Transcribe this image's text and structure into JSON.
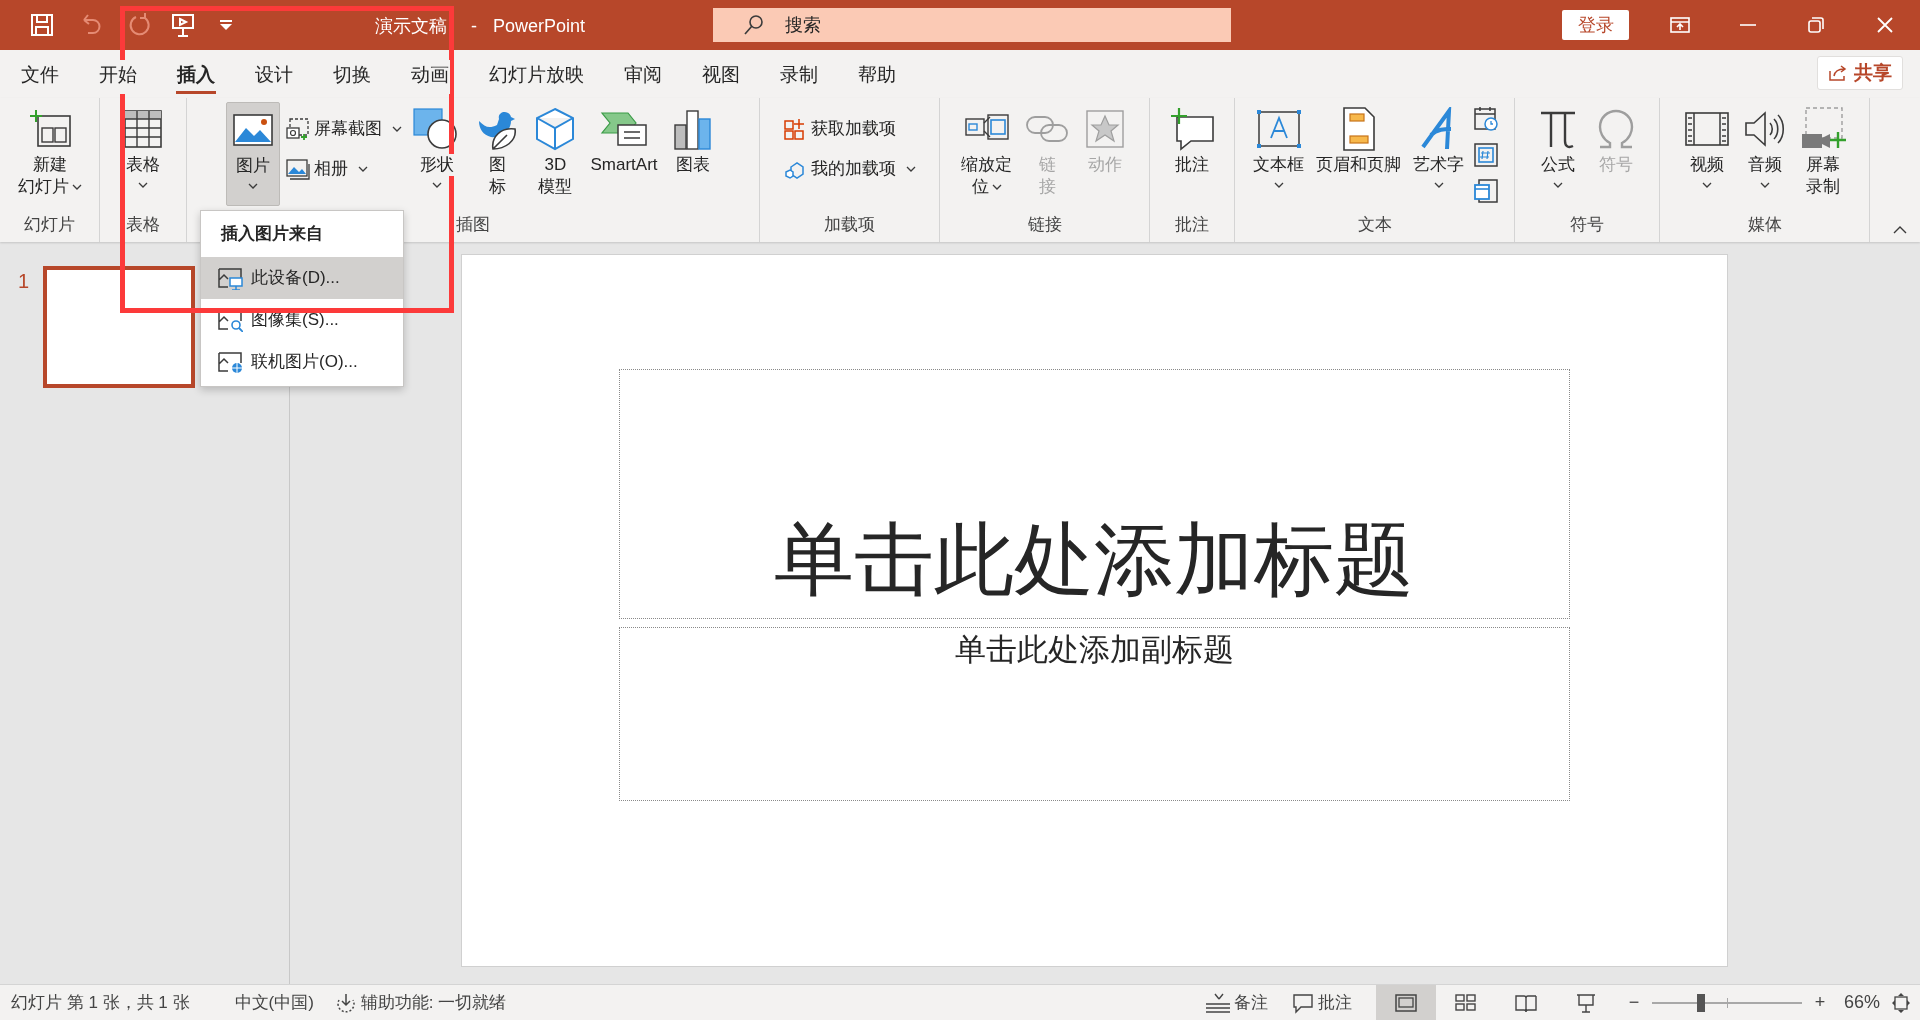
{
  "title_bar": {
    "quick_access": [
      {
        "disabled": false
      },
      {
        "disabled": true
      },
      {
        "disabled": true
      },
      {
        "disabled": false
      },
      {
        "disabled": false
      }
    ],
    "document_title": "演示文稿",
    "separator": "-",
    "app_name": "PowerPoint",
    "search": {
      "placeholder": "搜索"
    },
    "sign_in": "登录"
  },
  "tabs": [
    {
      "label": "文件",
      "selected": false
    },
    {
      "label": "开始",
      "selected": false
    },
    {
      "label": "插入",
      "selected": true
    },
    {
      "label": "设计",
      "selected": false
    },
    {
      "label": "切换",
      "selected": false
    },
    {
      "label": "动画",
      "selected": false
    },
    {
      "label": "幻灯片放映",
      "selected": false
    },
    {
      "label": "审阅",
      "selected": false
    },
    {
      "label": "视图",
      "selected": false
    },
    {
      "label": "录制",
      "selected": false
    },
    {
      "label": "帮助",
      "selected": false
    }
  ],
  "share": "共享",
  "ribbon": [
    {
      "label": "幻灯片",
      "commands": [
        {
          "kind": "large",
          "lines": [
            "新建",
            "幻灯片"
          ],
          "dropdown": true,
          "disabled": false,
          "pressed": false
        }
      ]
    },
    {
      "label": "表格",
      "commands": [
        {
          "kind": "large",
          "lines": [
            "表格"
          ],
          "dropdown": true,
          "disabled": false,
          "pressed": false
        }
      ]
    },
    {
      "label": "插图",
      "commands": [
        {
          "kind": "large",
          "lines": [
            "图片"
          ],
          "dropdown": true,
          "disabled": false,
          "pressed": true
        },
        {
          "kind": "stack",
          "items": [
            {
              "label": "屏幕截图",
              "dropdown": true
            },
            {
              "label": "相册",
              "dropdown": true
            }
          ]
        },
        {
          "kind": "large",
          "lines": [
            "形状"
          ],
          "dropdown": true,
          "disabled": false,
          "pressed": false
        },
        {
          "kind": "large",
          "lines": [
            "图",
            "标"
          ],
          "dropdown": false,
          "disabled": false,
          "pressed": false
        },
        {
          "kind": "large",
          "lines": [
            "3D",
            "模型"
          ],
          "dropdown": false,
          "disabled": false,
          "pressed": false
        },
        {
          "kind": "large",
          "lines": [
            "SmartArt"
          ],
          "dropdown": false,
          "disabled": false,
          "pressed": false
        },
        {
          "kind": "large",
          "lines": [
            "图表"
          ],
          "dropdown": false,
          "disabled": false,
          "pressed": false
        }
      ]
    },
    {
      "label": "加载项",
      "commands": [
        {
          "kind": "stack",
          "items": [
            {
              "label": "获取加载项",
              "dropdown": false
            },
            {
              "label": "我的加载项",
              "dropdown": true
            }
          ]
        }
      ]
    },
    {
      "label": "链接",
      "commands": [
        {
          "kind": "large",
          "lines": [
            "缩放定",
            "位"
          ],
          "dropdown": true,
          "disabled": false,
          "pressed": false
        },
        {
          "kind": "large",
          "lines": [
            "链",
            "接"
          ],
          "dropdown": false,
          "disabled": true,
          "pressed": false
        },
        {
          "kind": "large",
          "lines": [
            "动作"
          ],
          "dropdown": false,
          "disabled": true,
          "pressed": false
        }
      ]
    },
    {
      "label": "批注",
      "commands": [
        {
          "kind": "large",
          "lines": [
            "批注"
          ],
          "dropdown": false,
          "disabled": false,
          "pressed": false
        }
      ]
    },
    {
      "label": "文本",
      "commands": [
        {
          "kind": "large",
          "lines": [
            "文本框"
          ],
          "dropdown": true,
          "disabled": false,
          "pressed": false
        },
        {
          "kind": "large",
          "lines": [
            "页眉和页脚"
          ],
          "dropdown": false,
          "disabled": false,
          "pressed": false
        },
        {
          "kind": "large",
          "lines": [
            "艺术字"
          ],
          "dropdown": true,
          "disabled": false,
          "pressed": false
        },
        {
          "kind": "icons"
        }
      ]
    },
    {
      "label": "符号",
      "commands": [
        {
          "kind": "large",
          "lines": [
            "公式"
          ],
          "dropdown": true,
          "disabled": false,
          "pressed": false
        },
        {
          "kind": "large",
          "lines": [
            "符号"
          ],
          "dropdown": false,
          "disabled": true,
          "pressed": false
        }
      ]
    },
    {
      "label": "媒体",
      "commands": [
        {
          "kind": "large",
          "lines": [
            "视频"
          ],
          "dropdown": true,
          "disabled": false,
          "pressed": false
        },
        {
          "kind": "large",
          "lines": [
            "音频"
          ],
          "dropdown": true,
          "disabled": false,
          "pressed": false
        },
        {
          "kind": "large",
          "lines": [
            "屏幕",
            "录制"
          ],
          "dropdown": false,
          "disabled": false,
          "pressed": false
        }
      ]
    }
  ],
  "picture_menu": {
    "header": "插入图片来自",
    "items": [
      {
        "label": "此设备(D)...",
        "selected": true
      },
      {
        "label": "图像集(S)...",
        "selected": false
      },
      {
        "label": "联机图片(O)...",
        "selected": false
      }
    ]
  },
  "slides_panel": [
    {
      "number": "1",
      "selected": true
    }
  ],
  "slide": {
    "title_placeholder": "单击此处添加标题",
    "subtitle_placeholder": "单击此处添加副标题"
  },
  "status_bar": {
    "slide_info": "幻灯片 第 1 张，共 1 张",
    "language": "中文(中国)",
    "accessibility": "辅助功能: 一切就绪",
    "notes": "备注",
    "comments": "批注",
    "views": [
      {
        "selected": true
      },
      {
        "selected": false
      },
      {
        "selected": false
      },
      {
        "selected": false
      }
    ],
    "zoom_out": "−",
    "zoom_in": "+",
    "zoom": {
      "level": 0.33
    },
    "zoom_percent": "66%"
  }
}
